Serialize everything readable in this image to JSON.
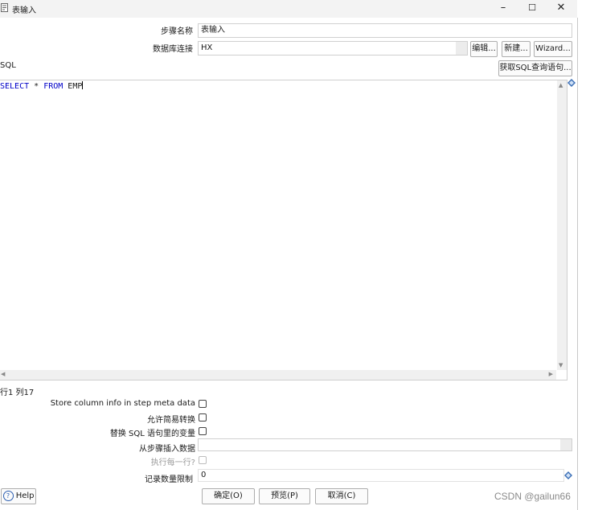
{
  "window": {
    "title": "表输入",
    "controls": {
      "minimize": "–",
      "maximize": "☐",
      "close": "✕"
    }
  },
  "form": {
    "step_name_label": "步骤名称",
    "step_name_value": "表输入",
    "db_conn_label": "数据库连接",
    "db_conn_value": "HX",
    "edit_btn": "编辑...",
    "new_btn": "新建...",
    "wizard_btn": "Wizard...",
    "sql_label": "SQL",
    "get_sql_btn": "获取SQL查询语句..."
  },
  "sql": {
    "kw_select": "SELECT",
    "star": " * ",
    "kw_from": "FROM",
    "table": " EMP"
  },
  "cursor_pos": "行1 列17",
  "options": {
    "store_column_info": {
      "label": "Store column info in step meta data",
      "checked": false
    },
    "lazy_conversion": {
      "label": "允许简易转换",
      "checked": false
    },
    "replace_variables": {
      "label": "替换 SQL 语句里的变量",
      "checked": false
    },
    "insert_from_step_label": "从步骤插入数据",
    "insert_from_step_value": "",
    "execute_each_row": {
      "label": "执行每一行?",
      "checked": false,
      "enabled": false
    },
    "limit_label": "记录数量限制",
    "limit_value": "0"
  },
  "footer": {
    "help": "Help",
    "ok": "确定(O)",
    "preview": "预览(P)",
    "cancel": "取消(C)"
  },
  "watermark": "CSDN @gailun66",
  "colors": {
    "keyword": "#0000c8",
    "titlebar": "#f3f3f3",
    "diamond": "#3b6fb6"
  }
}
